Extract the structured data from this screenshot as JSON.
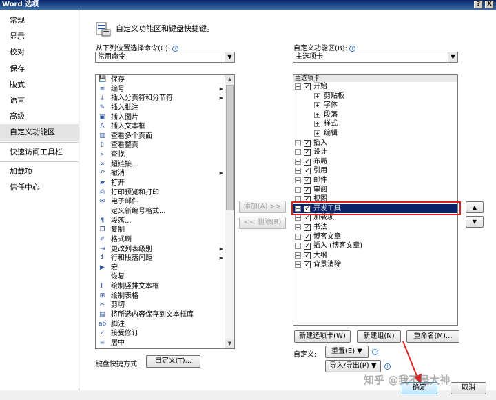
{
  "window": {
    "title": "Word 选项",
    "help_btn": "?",
    "close_btn": "X"
  },
  "sidebar": {
    "items": [
      {
        "label": "常规"
      },
      {
        "label": "显示"
      },
      {
        "label": "校对"
      },
      {
        "label": "保存"
      },
      {
        "label": "版式"
      },
      {
        "label": "语言"
      },
      {
        "label": "高级"
      },
      {
        "label": "自定义功能区"
      },
      {
        "label": "快速访问工具栏"
      },
      {
        "label": "加载项"
      },
      {
        "label": "信任中心"
      }
    ],
    "selected": "自定义功能区"
  },
  "main": {
    "heading": "自定义功能区和键盘快捷键。",
    "left_label": "从下列位置选择命令(C):",
    "left_combo_value": "常用命令",
    "right_label": "自定义功能区(B):",
    "right_combo_value": "主选项卡",
    "commands": [
      {
        "label": "保存",
        "icon": "save-icon",
        "sub": false
      },
      {
        "label": "编号",
        "icon": "numbering-icon",
        "sub": true
      },
      {
        "label": "插入分页符和分节符",
        "icon": "page-break-icon",
        "sub": true
      },
      {
        "label": "插入批注",
        "icon": "comment-icon",
        "sub": false
      },
      {
        "label": "插入图片",
        "icon": "picture-icon",
        "sub": false
      },
      {
        "label": "插入文本框",
        "icon": "textbox-icon",
        "sub": false
      },
      {
        "label": "查看多个页面",
        "icon": "multi-page-icon",
        "sub": false
      },
      {
        "label": "查看整页",
        "icon": "full-page-icon",
        "sub": false
      },
      {
        "label": "查找",
        "icon": "find-icon",
        "sub": false
      },
      {
        "label": "超链接...",
        "icon": "hyperlink-icon",
        "sub": false
      },
      {
        "label": "撤消",
        "icon": "undo-icon",
        "sub": true
      },
      {
        "label": "打开",
        "icon": "open-folder-icon",
        "sub": false
      },
      {
        "label": "打印预览和打印",
        "icon": "print-preview-icon",
        "sub": false
      },
      {
        "label": "电子邮件",
        "icon": "email-icon",
        "sub": false
      },
      {
        "label": "定义新编号格式...",
        "icon": "blank-icon",
        "sub": false
      },
      {
        "label": "段落...",
        "icon": "paragraph-icon",
        "sub": false
      },
      {
        "label": "复制",
        "icon": "copy-icon",
        "sub": false
      },
      {
        "label": "格式刷",
        "icon": "format-painter-icon",
        "sub": false
      },
      {
        "label": "更改列表级别",
        "icon": "list-level-icon",
        "sub": true
      },
      {
        "label": "行和段落间距",
        "icon": "line-spacing-icon",
        "sub": true
      },
      {
        "label": "宏",
        "icon": "macro-icon",
        "sub": false
      },
      {
        "label": "恢复",
        "icon": "blank-icon",
        "sub": false
      },
      {
        "label": "绘制竖排文本框",
        "icon": "vertical-textbox-icon",
        "sub": false
      },
      {
        "label": "绘制表格",
        "icon": "draw-table-icon",
        "sub": false
      },
      {
        "label": "剪切",
        "icon": "cut-icon",
        "sub": false
      },
      {
        "label": "将所选内容保存到文本框库",
        "icon": "textbox-gallery-icon",
        "sub": false
      },
      {
        "label": "脚注",
        "icon": "footnote-icon",
        "sub": false
      },
      {
        "label": "接受修订",
        "icon": "accept-change-icon",
        "sub": false
      },
      {
        "label": "居中",
        "icon": "center-icon",
        "sub": false
      }
    ],
    "add_btn": "添加(A) >>",
    "remove_btn": "<< 删除(R)",
    "tree": {
      "header": "主选项卡",
      "rows": [
        {
          "label": "开始",
          "level": 0,
          "expander": "⊟",
          "checked": true
        },
        {
          "label": "剪贴板",
          "level": 1,
          "expander": "⊞",
          "checked": null
        },
        {
          "label": "字体",
          "level": 1,
          "expander": "⊞",
          "checked": null
        },
        {
          "label": "段落",
          "level": 1,
          "expander": "⊞",
          "checked": null
        },
        {
          "label": "样式",
          "level": 1,
          "expander": "⊞",
          "checked": null
        },
        {
          "label": "编辑",
          "level": 1,
          "expander": "⊞",
          "checked": null
        },
        {
          "label": "插入",
          "level": 0,
          "expander": "⊞",
          "checked": true
        },
        {
          "label": "设计",
          "level": 0,
          "expander": "⊞",
          "checked": true
        },
        {
          "label": "布局",
          "level": 0,
          "expander": "⊞",
          "checked": true
        },
        {
          "label": "引用",
          "level": 0,
          "expander": "⊞",
          "checked": true
        },
        {
          "label": "邮件",
          "level": 0,
          "expander": "⊞",
          "checked": true
        },
        {
          "label": "审阅",
          "level": 0,
          "expander": "⊞",
          "checked": true
        },
        {
          "label": "视图",
          "level": 0,
          "expander": "⊞",
          "checked": true
        },
        {
          "label": "开发工具",
          "level": 0,
          "expander": "⊞",
          "checked": true,
          "selected": true
        },
        {
          "label": "加载项",
          "level": 0,
          "expander": "⊞",
          "checked": true
        },
        {
          "label": "书法",
          "level": 0,
          "expander": "⊞",
          "checked": true
        },
        {
          "label": "博客文章",
          "level": 0,
          "expander": "⊞",
          "checked": true
        },
        {
          "label": "插入 (博客文章)",
          "level": 0,
          "expander": "⊞",
          "checked": true
        },
        {
          "label": "大纲",
          "level": 0,
          "expander": "⊞",
          "checked": true
        },
        {
          "label": "背景消除",
          "level": 0,
          "expander": "⊞",
          "checked": true
        }
      ]
    },
    "new_tab_btn": "新建选项卡(W)",
    "new_group_btn": "新建组(N)",
    "rename_btn": "重命名(M)...",
    "customize_label": "自定义:",
    "reset_btn": "重置(E) ▼",
    "import_export_btn": "导入/导出(P) ▼",
    "keyboard_label": "键盘快捷方式:",
    "keyboard_btn": "自定义(T)...",
    "move_up": "▲",
    "move_down": "▼"
  },
  "footer": {
    "ok_btn": "确定",
    "cancel_btn": "取消"
  },
  "watermark": "知乎 @我不是大神"
}
